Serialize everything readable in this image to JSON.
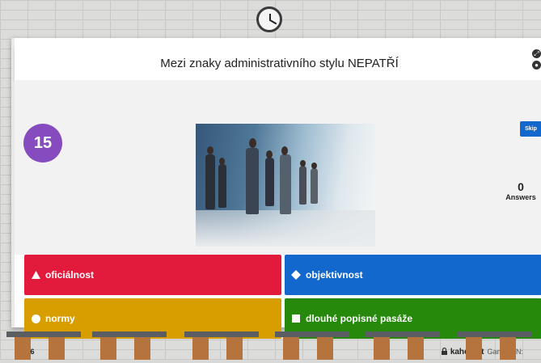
{
  "question": "Mezi znaky administrativního stylu NEPATŘÍ",
  "timer": "15",
  "skip_label": "Skip",
  "answers_count": "0",
  "answers_label": "Answers",
  "options": [
    {
      "label": "oficiálnost",
      "shape": "triangle-icon",
      "color": "#e21b3c"
    },
    {
      "label": "objektivnost",
      "shape": "diamond-icon",
      "color": "#1368ce"
    },
    {
      "label": "normy",
      "shape": "circle-icon",
      "color": "#d89e00"
    },
    {
      "label": "dlouhé popisné pasáže",
      "shape": "square-icon",
      "color": "#26890c"
    }
  ],
  "progress": "3/6",
  "brand": "kahoot.it",
  "game_pin_label": "Game PIN:"
}
